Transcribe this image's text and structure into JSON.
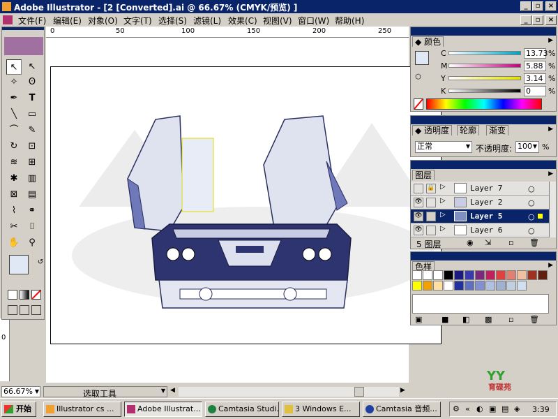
{
  "window": {
    "title": "Adobe Illustrator - [2 [Converted].ai @ 66.67% (CMYK/预览) ]"
  },
  "menu": [
    "文件(F)",
    "编辑(E)",
    "对象(O)",
    "文字(T)",
    "选择(S)",
    "滤镜(L)",
    "效果(C)",
    "视图(V)",
    "窗口(W)",
    "帮助(H)"
  ],
  "ruler": {
    "top_ticks": [
      "0",
      "50",
      "100",
      "150",
      "200",
      "250"
    ],
    "left_ticks": [
      "0"
    ]
  },
  "color_panel": {
    "title": "颜色",
    "channels": [
      {
        "label": "C",
        "value": "13.73",
        "unit": "%"
      },
      {
        "label": "M",
        "value": "5.88",
        "unit": "%"
      },
      {
        "label": "Y",
        "value": "3.14",
        "unit": "%"
      },
      {
        "label": "K",
        "value": "0",
        "unit": "%"
      }
    ]
  },
  "transparency_panel": {
    "tabs": [
      "透明度",
      "轮廓",
      "渐变"
    ],
    "blend_mode": "正常",
    "opacity_label": "不透明度:",
    "opacity_value": "100",
    "opacity_unit": "%"
  },
  "layers_panel": {
    "title": "图层",
    "layers": [
      {
        "name": "Layer 7",
        "visible": false,
        "locked": true,
        "selected": false
      },
      {
        "name": "Layer 2",
        "visible": true,
        "locked": false,
        "selected": false
      },
      {
        "name": "Layer 5",
        "visible": true,
        "locked": false,
        "selected": true
      },
      {
        "name": "Layer 6",
        "visible": true,
        "locked": false,
        "selected": false
      }
    ],
    "count_label": "5 图层"
  },
  "swatches_panel": {
    "title": "色样",
    "row1": [
      "#ffffff",
      "#ffffff",
      "#ffffff",
      "#000000",
      "#1a1a80",
      "#3a3ab0",
      "#7a2a7a",
      "#c02060",
      "#e04040",
      "#e08070",
      "#f0c0a0",
      "#a03020",
      "#602010"
    ],
    "row2": [
      "#ffff00",
      "#f0a000",
      "#ffe0a0",
      "#ffffff",
      "#2030a0",
      "#6070c0",
      "#8090d0",
      "#b0c0e0",
      "#a0b0d0",
      "#c0d0e0",
      "#d0e0f0"
    ]
  },
  "statusbar": {
    "zoom": "66.67%",
    "tool": "选取工具"
  },
  "taskbar": {
    "start": "开始",
    "tasks": [
      "Illustrator cs ...",
      "Adobe Illustrat...",
      "Camtasia Studi...",
      "3 Windows E...",
      "Camtasia 音频..."
    ],
    "clock": "3:39"
  },
  "watermark": {
    "text": "育碟苑"
  },
  "colors": {
    "titlebar": "#0a246a",
    "chrome": "#d4d0c8",
    "selection": "#0a246a"
  }
}
